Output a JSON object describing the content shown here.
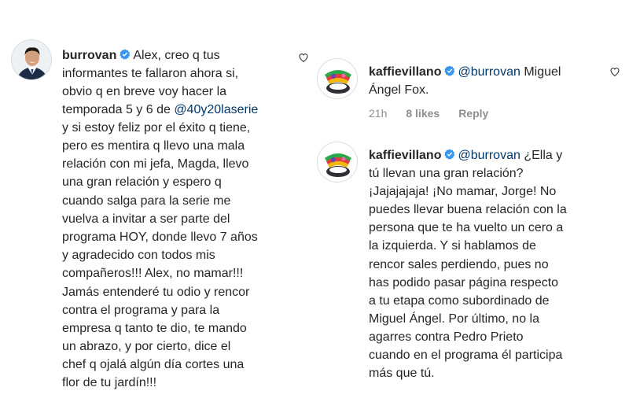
{
  "comments": [
    {
      "username": "burrovan",
      "verified": true,
      "lines": [
        {
          "parts": [
            {
              "t": "Alex, creo q tus"
            }
          ]
        },
        {
          "parts": [
            {
              "t": "informantes te fallaron ahora si,"
            }
          ]
        },
        {
          "parts": [
            {
              "t": "obvio q en breve voy hacer la"
            }
          ]
        },
        {
          "parts": [
            {
              "t": "temporada 5 y 6 de "
            },
            {
              "t": "@40y20laserie",
              "mention": true
            }
          ]
        },
        {
          "parts": [
            {
              "t": "y si estoy feliz por el éxito q tiene,"
            }
          ]
        },
        {
          "parts": [
            {
              "t": "pero es mentira q llevo una mala"
            }
          ]
        },
        {
          "parts": [
            {
              "t": "relación con mi jefa, Magda, llevo"
            }
          ]
        },
        {
          "parts": [
            {
              "t": "una gran relación y espero q"
            }
          ]
        },
        {
          "parts": [
            {
              "t": "cuando salga para la serie me"
            }
          ]
        },
        {
          "parts": [
            {
              "t": "vuelva a invitar a ser parte del"
            }
          ]
        },
        {
          "parts": [
            {
              "t": "programa HOY, donde llevo 7 años"
            }
          ]
        },
        {
          "parts": [
            {
              "t": "y agradecido con todos mis"
            }
          ]
        },
        {
          "parts": [
            {
              "t": "compañeros!!! Alex, no mamar!!!"
            }
          ]
        },
        {
          "parts": [
            {
              "t": "Jamás entenderé tu odio y rencor"
            }
          ]
        },
        {
          "parts": [
            {
              "t": "contra el programa y para la"
            }
          ]
        },
        {
          "parts": [
            {
              "t": "empresa q tanto te dio, te mando"
            }
          ]
        },
        {
          "parts": [
            {
              "t": "un abrazo, y por cierto, dice el"
            }
          ]
        },
        {
          "parts": [
            {
              "t": "chef q ojalá algún día cortes una"
            }
          ]
        },
        {
          "parts": [
            {
              "t": "flor de tu jardín!!!"
            }
          ]
        }
      ]
    },
    {
      "username": "kaffievillano",
      "verified": true,
      "lines": [
        {
          "parts": [
            {
              "t": "@burrovan",
              "mention": true
            },
            {
              "t": " Miguel"
            }
          ]
        },
        {
          "parts": [
            {
              "t": "Ángel Fox."
            }
          ]
        }
      ],
      "meta": {
        "time": "21h",
        "likes": "8 likes",
        "reply": "Reply"
      }
    },
    {
      "username": "kaffievillano",
      "verified": true,
      "lines": [
        {
          "parts": [
            {
              "t": "@burrovan",
              "mention": true
            },
            {
              "t": " ¿Ella y"
            }
          ]
        },
        {
          "parts": [
            {
              "t": "tú llevan una gran relación?"
            }
          ]
        },
        {
          "parts": [
            {
              "t": "¡Jajajajaja! ¡No mamar, Jorge! No"
            }
          ]
        },
        {
          "parts": [
            {
              "t": "puedes llevar buena relación con la"
            }
          ]
        },
        {
          "parts": [
            {
              "t": "persona que te ha vuelto un cero a"
            }
          ]
        },
        {
          "parts": [
            {
              "t": "la izquierda. Y si hablamos de"
            }
          ]
        },
        {
          "parts": [
            {
              "t": "rencor sales perdiendo, pues no"
            }
          ]
        },
        {
          "parts": [
            {
              "t": "has podido pasar página respecto"
            }
          ]
        },
        {
          "parts": [
            {
              "t": "a tu etapa como subordinado de"
            }
          ]
        },
        {
          "parts": [
            {
              "t": "Miguel Ángel. Por último, no la"
            }
          ]
        },
        {
          "parts": [
            {
              "t": "agarres contra Pedro Prieto"
            }
          ]
        },
        {
          "parts": [
            {
              "t": "cuando en el programa él participa"
            }
          ]
        },
        {
          "parts": [
            {
              "t": "más que tú."
            }
          ]
        }
      ]
    }
  ],
  "icons": {
    "verified": "verified-badge-icon",
    "like": "heart-icon",
    "avatar_burrovan": "avatar-photo",
    "avatar_kaffie": "avatar-illustration"
  },
  "colors": {
    "text": "#262626",
    "mention": "#00376b",
    "meta": "#8e8e8e",
    "verified": "#3897f0"
  }
}
